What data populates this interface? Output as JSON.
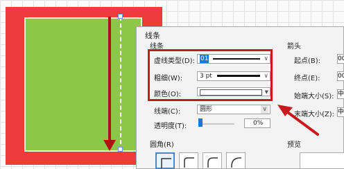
{
  "dialog": {
    "title": "线条",
    "line_section": "线条",
    "dash_type_label": "虚线类型(D):",
    "dash_type_value": "01",
    "weight_label": "粗细(W):",
    "weight_value": "3 pt",
    "color_label": "颜色(O):",
    "cap_label": "线端(C):",
    "cap_value": "圆形",
    "transparency_label": "透明度(T):",
    "transparency_value": "0%",
    "corner_section": "圆角(R)",
    "arrow_section": "箭头",
    "arrow_start_label": "起点(B):",
    "arrow_end_label": "终点(E):",
    "begin_size_label": "始端大小(S):",
    "end_size_label": "末端大小(Z):",
    "begin_size_value": "中",
    "end_size_value": "中",
    "arrow_start_value": "00",
    "arrow_end_value": "00",
    "preview_label": "预览"
  },
  "colors": {
    "shape_outline": "#ef3b3b",
    "shape_fill": "#8cc74a",
    "annotation": "#c8191e",
    "selection_accent": "#1e78d2"
  },
  "icons": [
    "chevron-down-icon",
    "arrow-annotation-icon",
    "corner-style-icon"
  ]
}
